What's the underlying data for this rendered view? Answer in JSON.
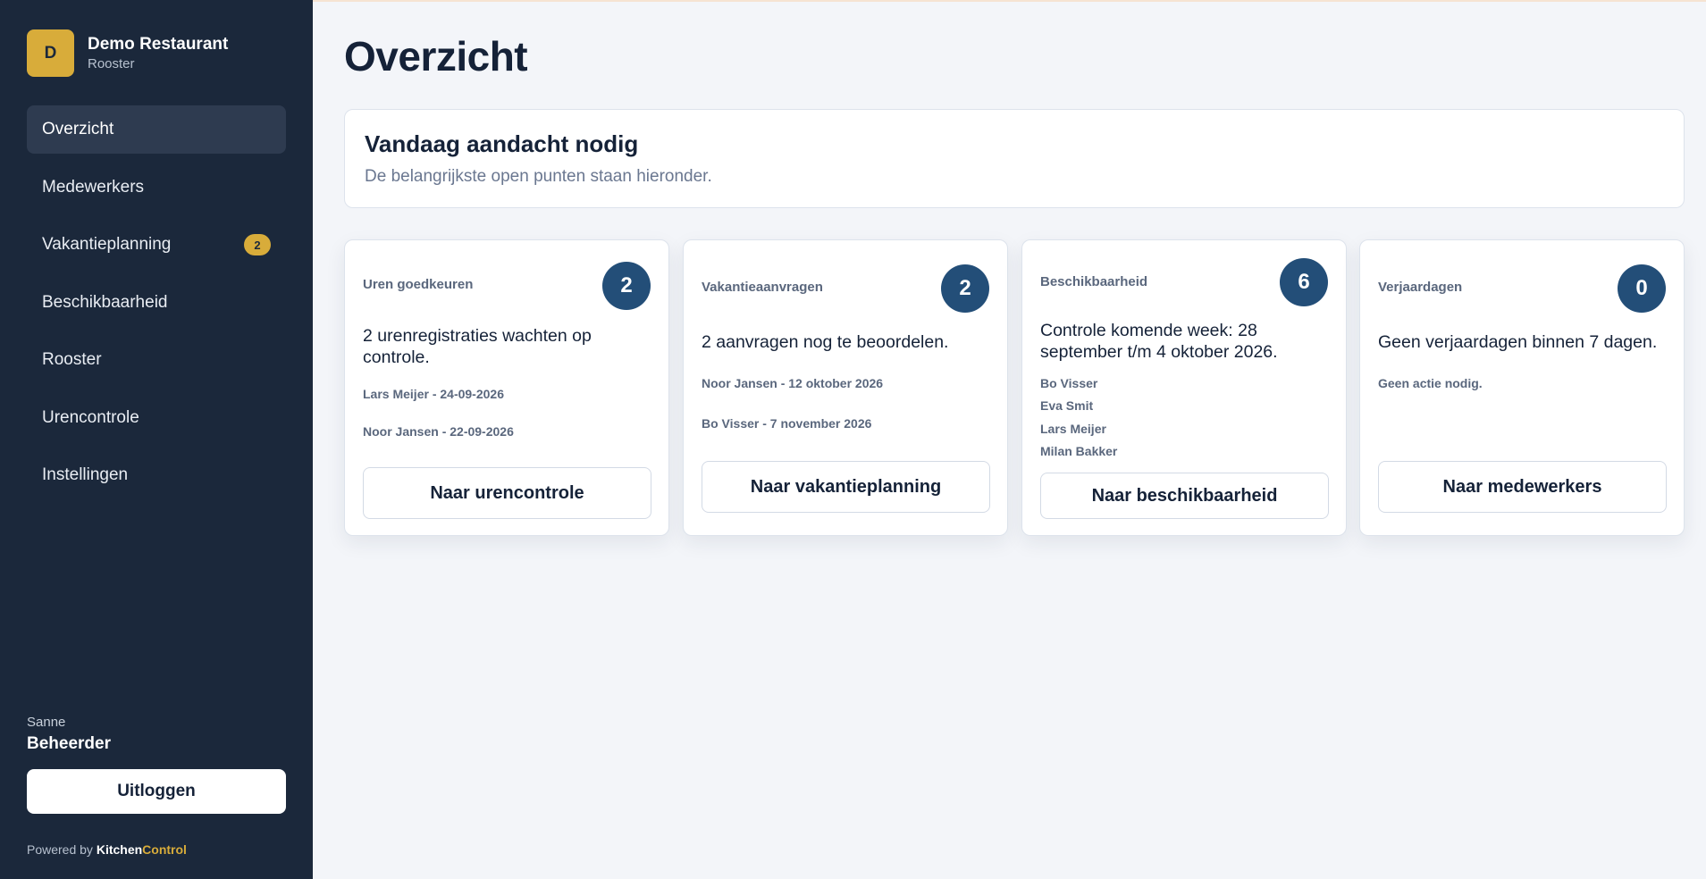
{
  "brand": {
    "initial": "D",
    "name": "Demo Restaurant",
    "subtitle": "Rooster"
  },
  "nav": {
    "items": [
      {
        "label": "Overzicht"
      },
      {
        "label": "Medewerkers"
      },
      {
        "label": "Vakantieplanning",
        "badge": "2"
      },
      {
        "label": "Beschikbaarheid"
      },
      {
        "label": "Rooster"
      },
      {
        "label": "Urencontrole"
      },
      {
        "label": "Instellingen"
      }
    ]
  },
  "user": {
    "name": "Sanne",
    "role": "Beheerder",
    "logout_label": "Uitloggen"
  },
  "footer": {
    "powered_prefix": "Powered by ",
    "brand_part1": "Kitchen",
    "brand_part2": "Control"
  },
  "main": {
    "title": "Overzicht",
    "attention": {
      "title": "Vandaag aandacht nodig",
      "subtitle": "De belangrijkste open punten staan hieronder."
    },
    "cards": [
      {
        "label": "Uren goedkeuren",
        "count": "2",
        "description": "2 urenregistraties wachten op controle.",
        "items": [
          "Lars Meijer - 24-09-2026",
          "Noor Jansen - 22-09-2026"
        ],
        "button": "Naar urencontrole"
      },
      {
        "label": "Vakantieaanvragen",
        "count": "2",
        "description": "2 aanvragen nog te beoordelen.",
        "items": [
          "Noor Jansen - 12 oktober 2026",
          "Bo Visser - 7 november 2026"
        ],
        "button": "Naar vakantieplanning"
      },
      {
        "label": "Beschikbaarheid",
        "count": "6",
        "description": "Controle komende week: 28 september t/m 4 oktober 2026.",
        "items": [
          "Bo Visser",
          "Eva Smit",
          "Lars Meijer",
          "Milan Bakker"
        ],
        "button": "Naar beschikbaarheid"
      },
      {
        "label": "Verjaardagen",
        "count": "0",
        "description": "Geen verjaardagen binnen 7 dagen.",
        "items": [
          "Geen actie nodig."
        ],
        "button": "Naar medewerkers"
      }
    ]
  },
  "colors": {
    "sidebar_bg": "#1b283b",
    "accent": "#d8ac3a",
    "count_badge": "#234e78",
    "page_bg": "#f3f5f9"
  }
}
